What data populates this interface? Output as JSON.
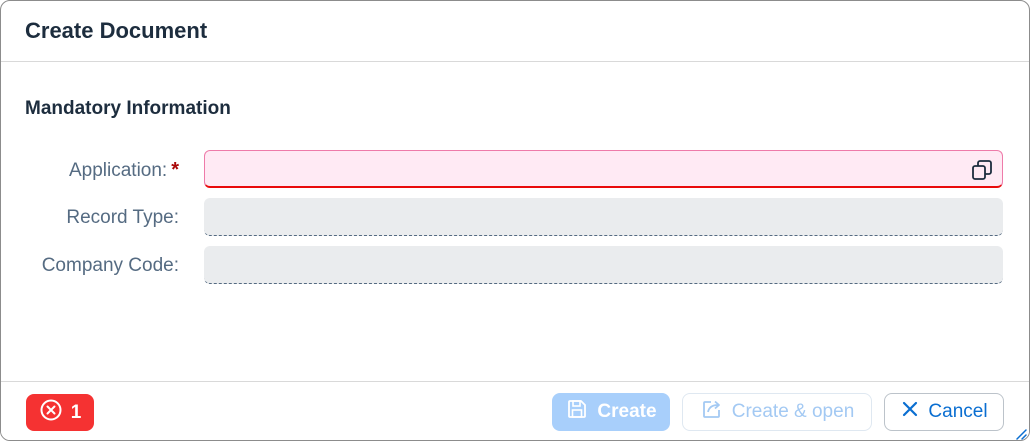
{
  "dialog": {
    "title": "Create Document"
  },
  "section": {
    "title": "Mandatory Information"
  },
  "fields": [
    {
      "label": "Application:",
      "required": true,
      "value": "",
      "state": "error",
      "icon": "value-help-icon"
    },
    {
      "label": "Record Type:",
      "required": false,
      "value": "",
      "state": "readonly"
    },
    {
      "label": "Company Code:",
      "required": false,
      "value": "",
      "state": "readonly"
    }
  ],
  "footer": {
    "error_count": "1",
    "error_icon": "error-circle-icon",
    "create_label": "Create",
    "create_icon": "save-icon",
    "create_open_label": "Create & open",
    "create_open_icon": "share-icon",
    "cancel_label": "Cancel",
    "cancel_icon": "close-icon"
  },
  "colors": {
    "error": "#e90b0b",
    "error_field_bg": "#ffeaf4",
    "required_star": "#aa0808",
    "accent": "#0a6ed1",
    "error_badge": "#f53232"
  }
}
